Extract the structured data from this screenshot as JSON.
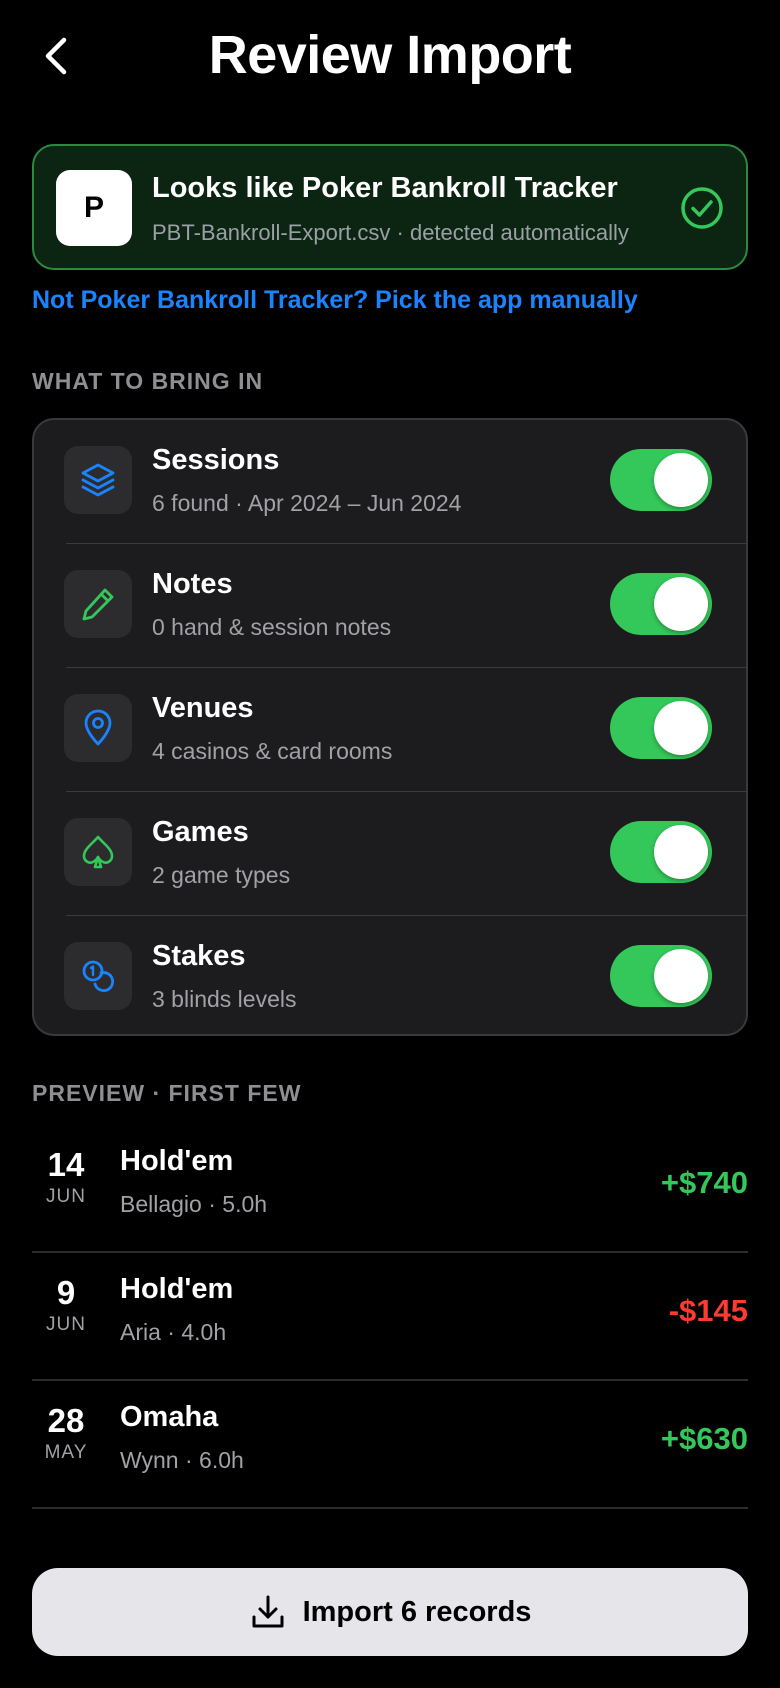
{
  "header": {
    "title": "Review Import"
  },
  "detection": {
    "logo_letter": "P",
    "title": "Looks like Poker Bankroll Tracker",
    "subtitle": "PBT-Bankroll-Export.csv · detected automatically",
    "manual_link": "Not Poker Bankroll Tracker? Pick the app manually"
  },
  "bring_in": {
    "label": "WHAT TO BRING IN",
    "items": [
      {
        "title": "Sessions",
        "subtitle": "6 found · Apr 2024 – Jun 2024",
        "icon": "stack-icon",
        "enabled": true
      },
      {
        "title": "Notes",
        "subtitle": "0 hand & session notes",
        "icon": "pencil-icon",
        "enabled": true
      },
      {
        "title": "Venues",
        "subtitle": "4 casinos & card rooms",
        "icon": "map-pin-icon",
        "enabled": true
      },
      {
        "title": "Games",
        "subtitle": "2 game types",
        "icon": "spade-icon",
        "enabled": true
      },
      {
        "title": "Stakes",
        "subtitle": "3 blinds levels",
        "icon": "chips-icon",
        "enabled": true
      }
    ]
  },
  "preview": {
    "label": "PREVIEW · FIRST FEW",
    "rows": [
      {
        "day": "14",
        "month": "JUN",
        "game": "Hold'em",
        "meta": "Bellagio · 5.0h",
        "amount": "+$740"
      },
      {
        "day": "9",
        "month": "JUN",
        "game": "Hold'em",
        "meta": "Aria · 4.0h",
        "amount": "-$145"
      },
      {
        "day": "28",
        "month": "MAY",
        "game": "Omaha",
        "meta": "Wynn · 6.0h",
        "amount": "+$630"
      }
    ]
  },
  "import_button": {
    "label": "Import 6 records"
  },
  "colors": {
    "accent_green": "#34c759",
    "loss_red": "#ff3b30",
    "link_blue": "#1a84ff"
  }
}
